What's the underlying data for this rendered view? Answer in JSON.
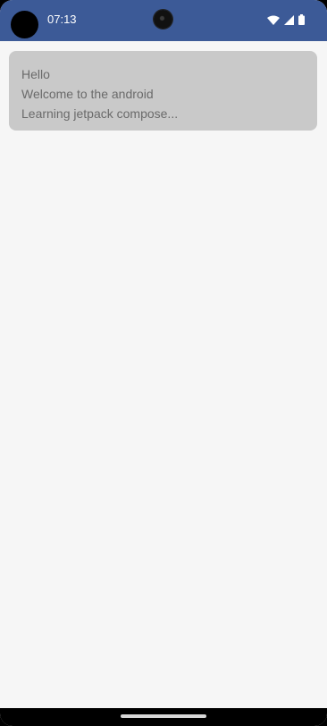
{
  "status_bar": {
    "time": "07:13",
    "icons": [
      "wifi-icon",
      "cellular-signal-icon",
      "battery-icon"
    ],
    "background_color": "#3c5a97"
  },
  "card": {
    "lines": [
      "Hello",
      "Welcome to the android",
      "Learning jetpack compose..."
    ],
    "background_color": "#c9c9c9"
  },
  "colors": {
    "screen_background": "#f6f6f6",
    "text": "#6a6a6a"
  }
}
